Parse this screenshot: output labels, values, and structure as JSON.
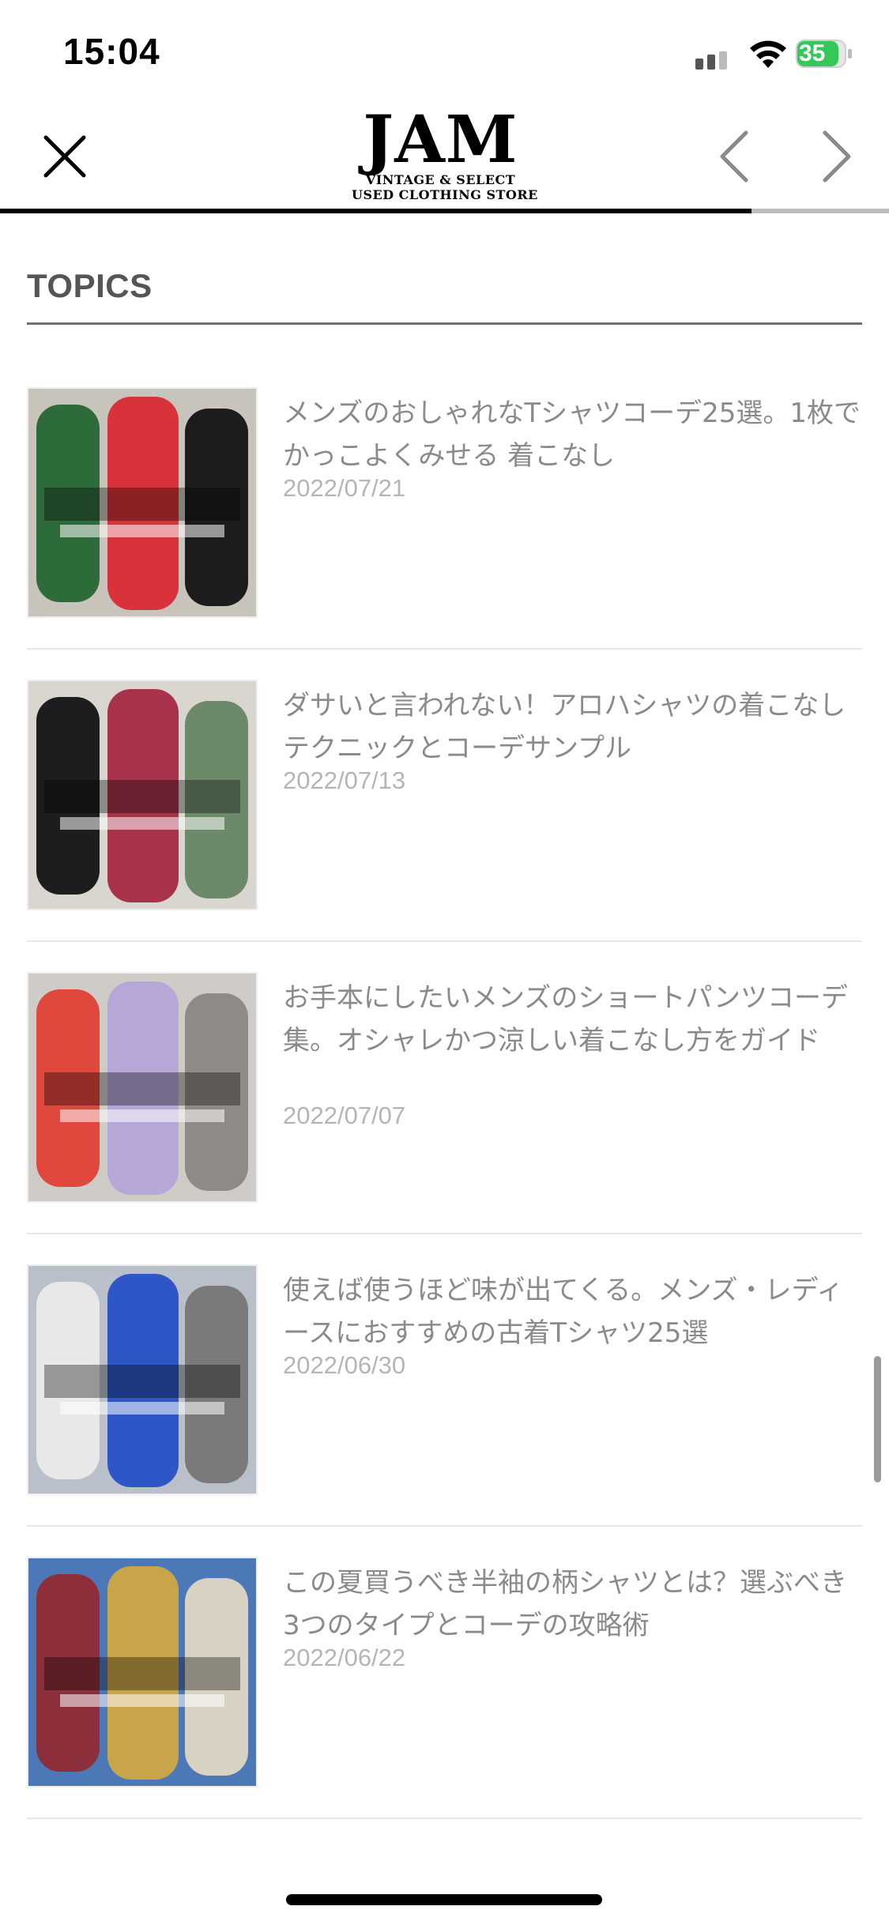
{
  "status_bar": {
    "time": "15:04",
    "battery": "35"
  },
  "nav": {
    "logo_main": "JAM",
    "logo_sub1": "VINTAGE & SELECT",
    "logo_sub2": "USED CLOTHING STORE",
    "load_progress": 0.845,
    "icons": {
      "close": "close-icon",
      "back": "chevron-left-icon",
      "forward": "chevron-right-icon"
    }
  },
  "section": {
    "title": "TOPICS"
  },
  "articles": [
    {
      "title": "メンズのおしゃれなTシャツコーデ25選。1枚でかっこよくみせる 着こなし",
      "date": "2022/07/21",
      "thumb_colors": [
        "#c9c4bb",
        "#2e6b3a",
        "#d8323a",
        "#1c1c1c"
      ]
    },
    {
      "title": "ダサいと言われない！アロハシャツの着こなしテクニックとコーデサンプル",
      "date": "2022/07/13",
      "thumb_colors": [
        "#d9d6cf",
        "#1d1d1d",
        "#a8324a",
        "#6c8a6a"
      ]
    },
    {
      "title": "お手本にしたいメンズのショートパンツコーデ集。オシャレかつ涼しい着こなし方をガイド",
      "date": "2022/07/07",
      "thumb_colors": [
        "#cfcbc6",
        "#e0473d",
        "#b6a7d8",
        "#8f8a86"
      ]
    },
    {
      "title": "使えば使うほど味が出てくる。メンズ・レディースにおすすめの古着Tシャツ25選",
      "date": "2022/06/30",
      "thumb_colors": [
        "#b9c0c9",
        "#e8e8e8",
        "#2f56c7",
        "#7a7a7a"
      ]
    },
    {
      "title": "この夏買うべき半袖の柄シャツとは？選ぶべき3つのタイプとコーデの攻略術",
      "date": "2022/06/22",
      "thumb_colors": [
        "#4d78b8",
        "#8c2f3a",
        "#c9a54a",
        "#d8d2c2"
      ]
    }
  ]
}
